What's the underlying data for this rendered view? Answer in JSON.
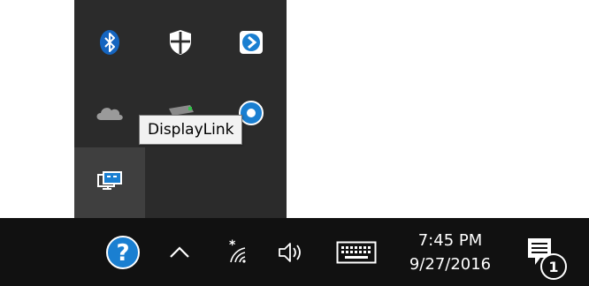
{
  "tray_flyout": {
    "icons": [
      {
        "name": "bluetooth-icon"
      },
      {
        "name": "windows-defender-icon"
      },
      {
        "name": "app-shortcut-icon"
      },
      {
        "name": "onedrive-icon"
      },
      {
        "name": "drive-icon"
      },
      {
        "name": "sync-icon"
      },
      {
        "name": "displaylink-icon"
      }
    ],
    "tooltip": "DisplayLink"
  },
  "taskbar": {
    "help_icon": "question-icon",
    "show_hidden_icons": "chevron-up-icon",
    "network_icon": "wifi-icon",
    "volume_icon": "speaker-icon",
    "keyboard_icon": "touch-keyboard-icon",
    "clock": {
      "time": "7:45 PM",
      "date": "9/27/2016"
    },
    "action_center": {
      "icon": "notifications-icon",
      "badge": "1"
    }
  },
  "colors": {
    "taskbar_bg": "#111111",
    "flyout_bg": "#2b2b2b",
    "accent": "#1a7fd1"
  }
}
